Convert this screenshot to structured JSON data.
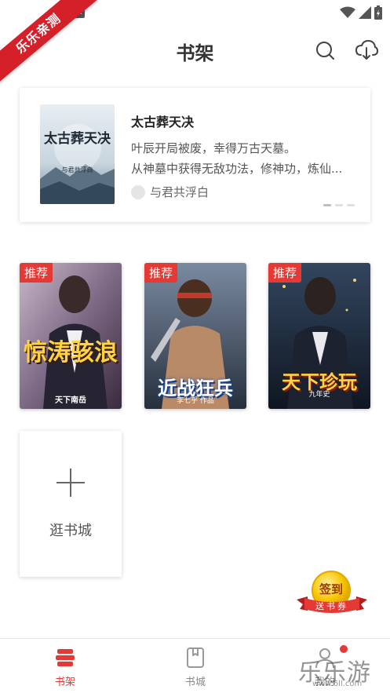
{
  "statusbar": {
    "notification_glyph": "A"
  },
  "ribbon": {
    "text": "乐乐亲测"
  },
  "header": {
    "title": "书架"
  },
  "featured": {
    "title": "太古葬天决",
    "desc_line1": "叶辰开局被废，幸得万古天墓。",
    "desc_line2": "从神墓中获得无敌功法，修神功，炼仙...",
    "author": "与君共浮白",
    "cover_title": "太古葬天决",
    "cover_author": "与君共浮白"
  },
  "shelf": {
    "books": [
      {
        "tag": "推荐",
        "cover_text": "惊涛骇浪",
        "cover_author": "天下南岳"
      },
      {
        "tag": "推荐",
        "cover_text": "近战狂兵",
        "cover_author": "李七乎 作品"
      },
      {
        "tag": "推荐",
        "cover_text": "天下珍玩",
        "cover_author": "九年史"
      }
    ],
    "add_label": "逛书城"
  },
  "signin": {
    "title": "签到",
    "subtitle": "送书券"
  },
  "bottom_nav": {
    "shelf": "书架",
    "store": "书城",
    "me": "我的"
  },
  "watermark": {
    "text": "乐乐游戏",
    "url": "www.6ll.com"
  },
  "colors": {
    "accent": "#e53935",
    "ribbon": "#d5202a"
  }
}
